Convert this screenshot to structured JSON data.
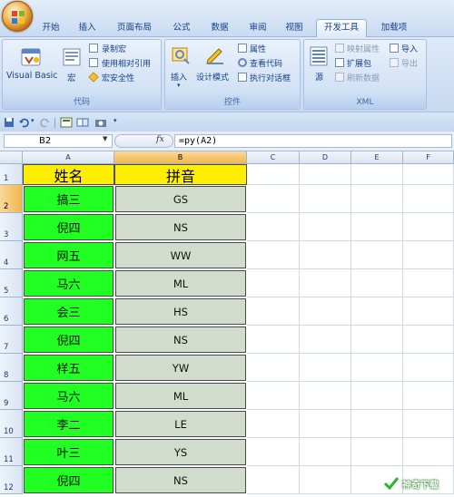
{
  "tabs": [
    {
      "label": "开始",
      "active": false
    },
    {
      "label": "插入",
      "active": false
    },
    {
      "label": "页面布局",
      "active": false
    },
    {
      "label": "公式",
      "active": false
    },
    {
      "label": "数据",
      "active": false
    },
    {
      "label": "审阅",
      "active": false
    },
    {
      "label": "视图",
      "active": false
    },
    {
      "label": "开发工具",
      "active": true
    },
    {
      "label": "加载项",
      "active": false
    }
  ],
  "ribbon": {
    "code_group": {
      "label": "代码",
      "visual_basic": "Visual Basic",
      "macro": "宏",
      "record_macro": "录制宏",
      "relative_ref": "使用相对引用",
      "macro_security": "宏安全性"
    },
    "controls_group": {
      "label": "控件",
      "insert": "插入",
      "design_mode": "设计模式",
      "properties": "属性",
      "view_code": "查看代码",
      "run_dialog": "执行对话框"
    },
    "xml_group": {
      "label": "XML",
      "source": "源",
      "map_props": "映射属性",
      "expansion_packs": "扩展包",
      "refresh_data": "刷新数据",
      "import": "导入",
      "export": "导出"
    }
  },
  "formula_bar": {
    "name_box": "B2",
    "fx": "fx",
    "formula": "=py(A2)"
  },
  "columns": [
    "A",
    "B",
    "C",
    "D",
    "E",
    "F"
  ],
  "rows": [
    "1",
    "2",
    "3",
    "4",
    "5",
    "6",
    "7",
    "8",
    "9",
    "10",
    "11",
    "12"
  ],
  "header_row": {
    "a": "姓名",
    "b": "拼音"
  },
  "data_rows": [
    {
      "name": "搞三",
      "pinyin": "GS"
    },
    {
      "name": "倪四",
      "pinyin": "NS"
    },
    {
      "name": "网五",
      "pinyin": "WW"
    },
    {
      "name": "马六",
      "pinyin": "ML"
    },
    {
      "name": "会三",
      "pinyin": "HS"
    },
    {
      "name": "倪四",
      "pinyin": "NS"
    },
    {
      "name": "样五",
      "pinyin": "YW"
    },
    {
      "name": "马六",
      "pinyin": "ML"
    },
    {
      "name": "李二",
      "pinyin": "LE"
    },
    {
      "name": "叶三",
      "pinyin": "YS"
    },
    {
      "name": "倪四",
      "pinyin": "NS"
    }
  ],
  "watermark": "神奇下载",
  "colors": {
    "name_fill": "#22ff22",
    "pinyin_fill": "#d1dccd",
    "header_fill": "#ffee00",
    "selected_header": "#f1b74e"
  }
}
